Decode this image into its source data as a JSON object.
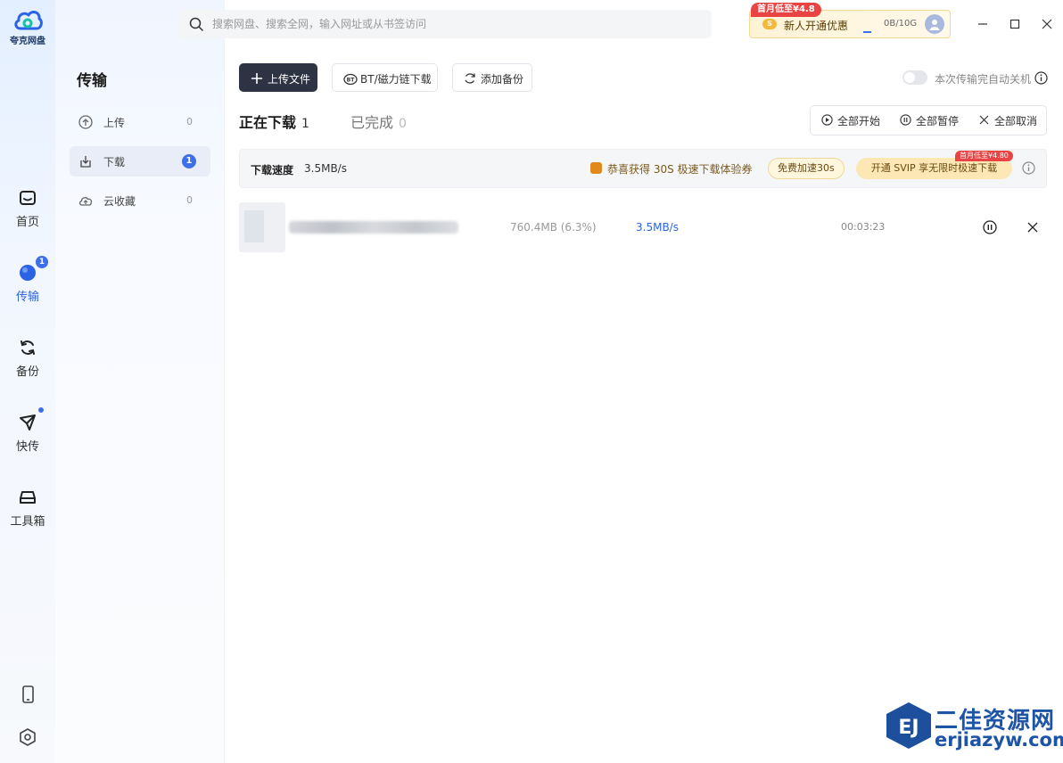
{
  "app": {
    "logo_text": "夸克网盘",
    "brand_color": "#2b62e6"
  },
  "rail": {
    "items": [
      {
        "label": "首页",
        "icon": "home-icon"
      },
      {
        "label": "传输",
        "icon": "transfer-icon",
        "badge": "1"
      },
      {
        "label": "备份",
        "icon": "backup-icon"
      },
      {
        "label": "快传",
        "icon": "send-icon"
      },
      {
        "label": "工具箱",
        "icon": "toolbox-icon"
      }
    ],
    "bottom_icons": [
      "phone-icon",
      "settings-icon"
    ]
  },
  "panel": {
    "title": "传输",
    "items": [
      {
        "label": "上传",
        "count": "0",
        "icon": "upload-icon"
      },
      {
        "label": "下载",
        "count": "1",
        "icon": "download-icon"
      },
      {
        "label": "云收藏",
        "count": "0",
        "icon": "cloud-icon"
      }
    ]
  },
  "search": {
    "placeholder": "搜索网盘、搜索全网，输入网址或从书签访问"
  },
  "promo": {
    "tag": "首月低至¥4.8",
    "coin": "S",
    "text": "新人开通优惠",
    "quota": "0B/10G"
  },
  "toolbar": {
    "upload_label": "上传文件",
    "bt_label": "BT/磁力链下载",
    "backup_label": "添加备份",
    "auto_shutdown_label": "本次传输完自动关机"
  },
  "tabs": [
    {
      "name": "正在下载",
      "count": "1"
    },
    {
      "name": "已完成",
      "count": "0"
    }
  ],
  "controls": {
    "start_all": "全部开始",
    "pause_all": "全部暂停",
    "cancel_all": "全部取消"
  },
  "speedbar": {
    "label": "下载速度",
    "value": "3.5MB/s",
    "message": "恭喜获得 30S 极速下载体验券",
    "free_boost": "免费加速30s",
    "svip_label": "开通 SVIP 享无限时极速下载",
    "svip_tag": "首月低至¥4.80"
  },
  "downloads": [
    {
      "size_progress": "760.4MB (6.3%)",
      "speed": "3.5MB/s",
      "eta": "00:03:23"
    }
  ],
  "watermark": {
    "text": "二佳资源网",
    "url": "erjiazyw.com",
    "logo": "EJ"
  }
}
